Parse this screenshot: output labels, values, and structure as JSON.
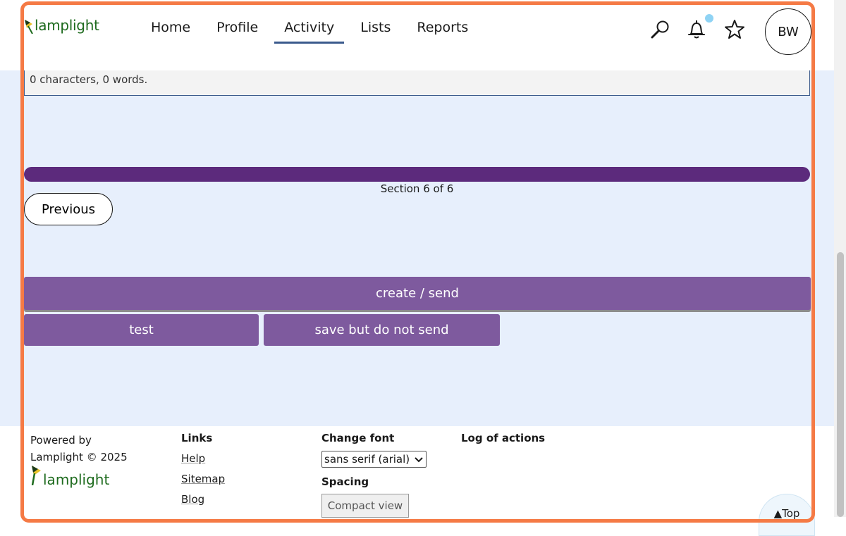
{
  "header": {
    "logo_text": "lamplight",
    "nav": [
      {
        "label": "Home",
        "active": false
      },
      {
        "label": "Profile",
        "active": false
      },
      {
        "label": "Activity",
        "active": true
      },
      {
        "label": "Lists",
        "active": false
      },
      {
        "label": "Reports",
        "active": false
      }
    ],
    "icons": [
      "search-icon",
      "bell-icon",
      "star-icon"
    ],
    "avatar_initials": "BW"
  },
  "main": {
    "char_count_text": "0 characters, 0 words.",
    "progress": {
      "current": 6,
      "total": 6,
      "label": "Section 6 of 6",
      "fraction": 1.0
    },
    "previous_label": "Previous",
    "create_send_label": "create / send",
    "test_label": "test",
    "save_label": "save but do not send"
  },
  "footer": {
    "powered_by": "Powered by",
    "copyright": "Lamplight © 2025",
    "logo_text": "lamplight",
    "links_heading": "Links",
    "links": [
      "Help",
      "Sitemap",
      "Blog"
    ],
    "font_heading": "Change font",
    "font_selected": "sans serif (arial)",
    "spacing_heading": "Spacing",
    "compact_label": "Compact view",
    "log_heading": "Log of actions",
    "top_label": "▲Top"
  },
  "colors": {
    "accent_purple": "#7e5a9e",
    "progress_purple": "#5c2a7c",
    "main_bg": "#e7effc",
    "highlight": "#f57a45",
    "logo_green": "#1e6b1e"
  }
}
